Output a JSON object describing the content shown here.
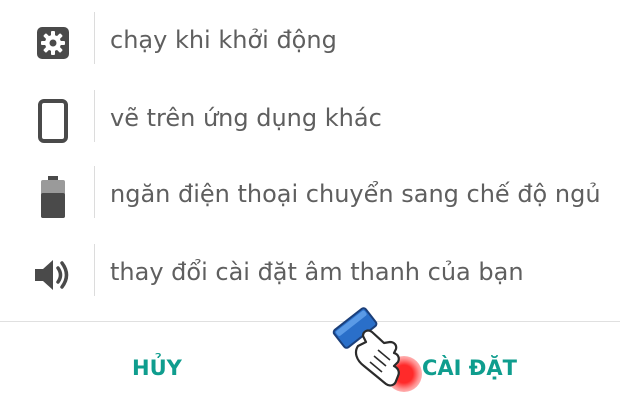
{
  "permissions": [
    {
      "icon": "gear-icon",
      "label": "chạy khi khởi động"
    },
    {
      "icon": "phone-icon",
      "label": "vẽ trên ứng dụng khác"
    },
    {
      "icon": "battery-icon",
      "label": "ngăn điện thoại chuyển sang chế độ ngủ"
    },
    {
      "icon": "speaker-icon",
      "label": "thay đổi cài đặt âm thanh của bạn"
    }
  ],
  "buttons": {
    "cancel": "HỦY",
    "install": "CÀI ĐẶT"
  },
  "colors": {
    "accent": "#0f9d8e",
    "icon": "#4a4a4a",
    "text": "#5f5f5f",
    "tap_indicator": "#ff2a2a",
    "cursor_cuff": "#2a6fc9"
  },
  "overlay": {
    "cursor": "pointing-hand-cursor-icon"
  }
}
